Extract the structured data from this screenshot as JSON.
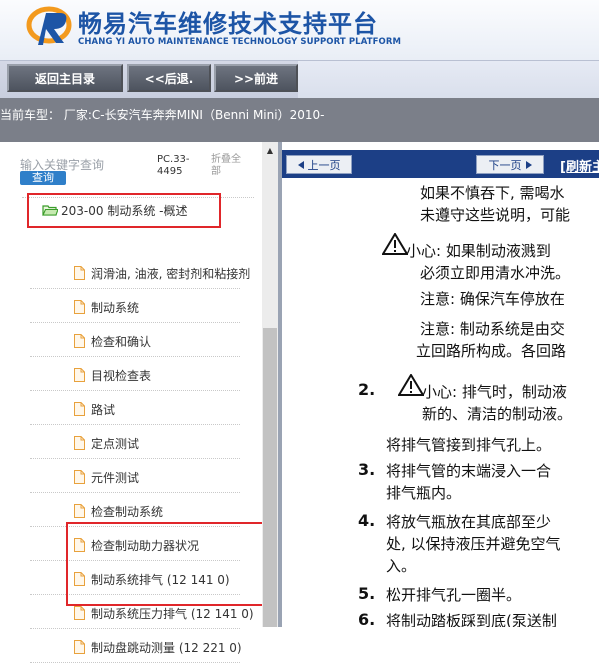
{
  "header": {
    "title": "畅易汽车维修技术支持平台",
    "subtitle": "CHANG YI AUTO MAINTENANCE TECHNOLOGY SUPPORT PLATFORM",
    "brand_color": "#1d55a6"
  },
  "toolbar": {
    "home_label": "返回主目录",
    "back_label": "<<后退.",
    "forward_label": ">>前进"
  },
  "vehicle": {
    "text": "当前车型：  厂家:C-长安汽车奔奔MINI（Benni Mini）2010-"
  },
  "sidebar": {
    "search_label": "输入关键字查询",
    "search_button": "查询",
    "pc_code": "PC.33-4495",
    "collapse_all": "折叠全部",
    "folder": "203-00 制动系统 -概述",
    "items": [
      "润滑油, 油液, 密封剂和粘接剂",
      "制动系统",
      "检查和确认",
      "目视检查表",
      "路试",
      "定点测试",
      "元件测试",
      "检查制动系统",
      "检查制动助力器状况",
      "制动系统排气 (12 141 0)",
      "制动系统压力排气 (12 141 0)",
      "制动盘跳动测量 (12 221 0)"
    ]
  },
  "doc_nav": {
    "prev": "上一页",
    "next": "下一页",
    "refresh": "[刷新主"
  },
  "document": {
    "lines": [
      "如果不慎吞下, 需喝水",
      "未遵守这些说明，可能",
      "小心: 如果制动液溅到",
      "必须立即用清水冲洗。",
      "注意: 确保汽车停放在",
      "注意: 制动系统是由交",
      "立回路所构成。各回路",
      "小心: 排气时，制动液",
      "新的、清洁的制动液。",
      "将排气管接到排气孔上。",
      "将排气管的末端浸入一合",
      "排气瓶内。",
      "将放气瓶放在其底部至少",
      "处, 以保持液压并避免空气",
      "入。",
      "松开排气孔一圈半。",
      "将制动踏板踩到底(泵送制"
    ],
    "numbers": [
      "2.",
      "3.",
      "4.",
      "5.",
      "6."
    ]
  }
}
